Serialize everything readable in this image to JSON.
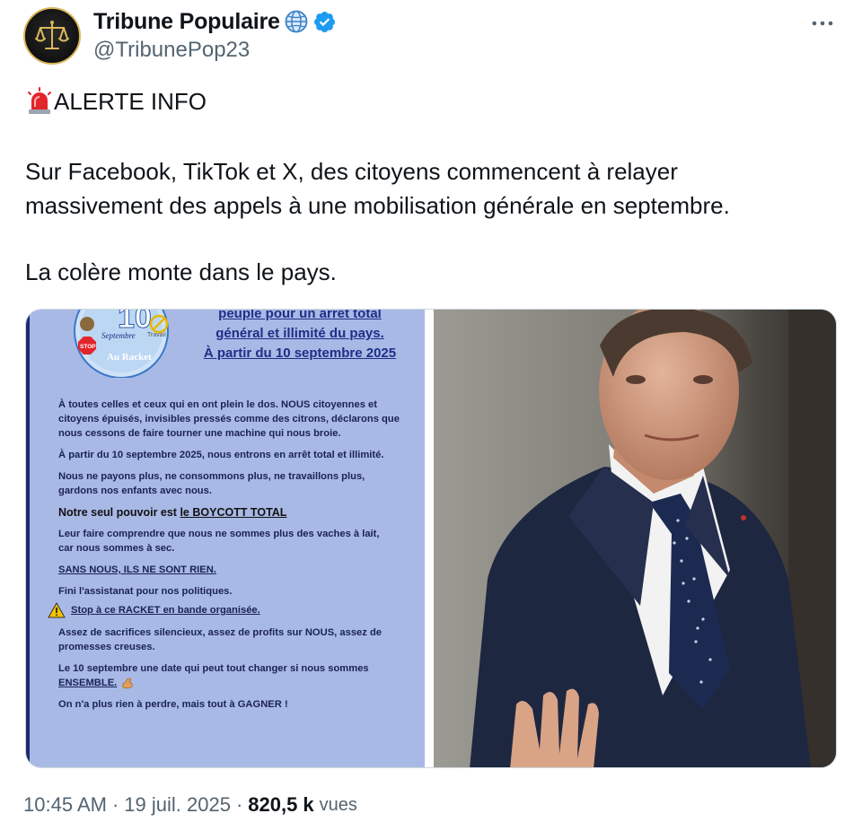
{
  "author": {
    "display_name": "Tribune Populaire",
    "handle": "@TribunePop23",
    "avatar_icon": "scales-of-justice-icon",
    "globe_icon": "globe-icon",
    "verified_icon": "verified-badge-icon",
    "accent": "#1d9bf0"
  },
  "tweet": {
    "alert_icon": "rotating-light-icon",
    "alert_label": "ALERTE INFO",
    "paragraph_1_line_1": "Sur Facebook, TikTok et X, des citoyens commencent à relayer",
    "paragraph_1_line_2": "massivement des appels à une mobilisation générale en septembre.",
    "paragraph_2": "La colère monte dans le pays."
  },
  "media": {
    "poster": {
      "logo_number": "10",
      "logo_month": "Septembre",
      "logo_stop": "STOP",
      "logo_travail": "Travail",
      "logo_caption": "Au Racket",
      "head_line_1": "peuple pour un arrêt total",
      "head_line_2": "général et illimité du pays.",
      "head_line_3": "À partir du 10 septembre 2025",
      "lines": [
        "À toutes celles et ceux qui en ont plein le dos. NOUS citoyennes et",
        "citoyens épuisés, invisibles pressés comme des citrons, déclarons que",
        "nous cessons de faire tourner une machine qui nous broie.",
        "À partir du 10 septembre 2025, nous entrons en arrêt total et illimité.",
        "Nous ne payons plus, ne consommons plus, ne travaillons plus,",
        "gardons nos enfants avec nous.",
        "Notre seul pouvoir est ",
        "le BOYCOTT TOTAL",
        "Leur faire comprendre que nous ne sommes plus des vaches à lait,",
        "car nous sommes à sec.",
        "SANS NOUS, ILS NE SONT RIEN.",
        "Fini l'assistanat pour nos politiques.",
        "Stop à ce RACKET en bande organisée.",
        "Assez de sacrifices silencieux, assez de profits sur NOUS, assez de",
        "promesses creuses.",
        "Le 10 septembre une date qui peut tout changer si nous sommes",
        "ENSEMBLE.",
        "On n'a plus rien à perdre, mais tout à GAGNER !"
      ]
    }
  },
  "meta": {
    "time": "10:45 AM",
    "separator": "·",
    "date": "19 juil. 2025",
    "views_count": "820,5 k",
    "views_label": "vues"
  },
  "more_icon": "more-horizontal-icon"
}
